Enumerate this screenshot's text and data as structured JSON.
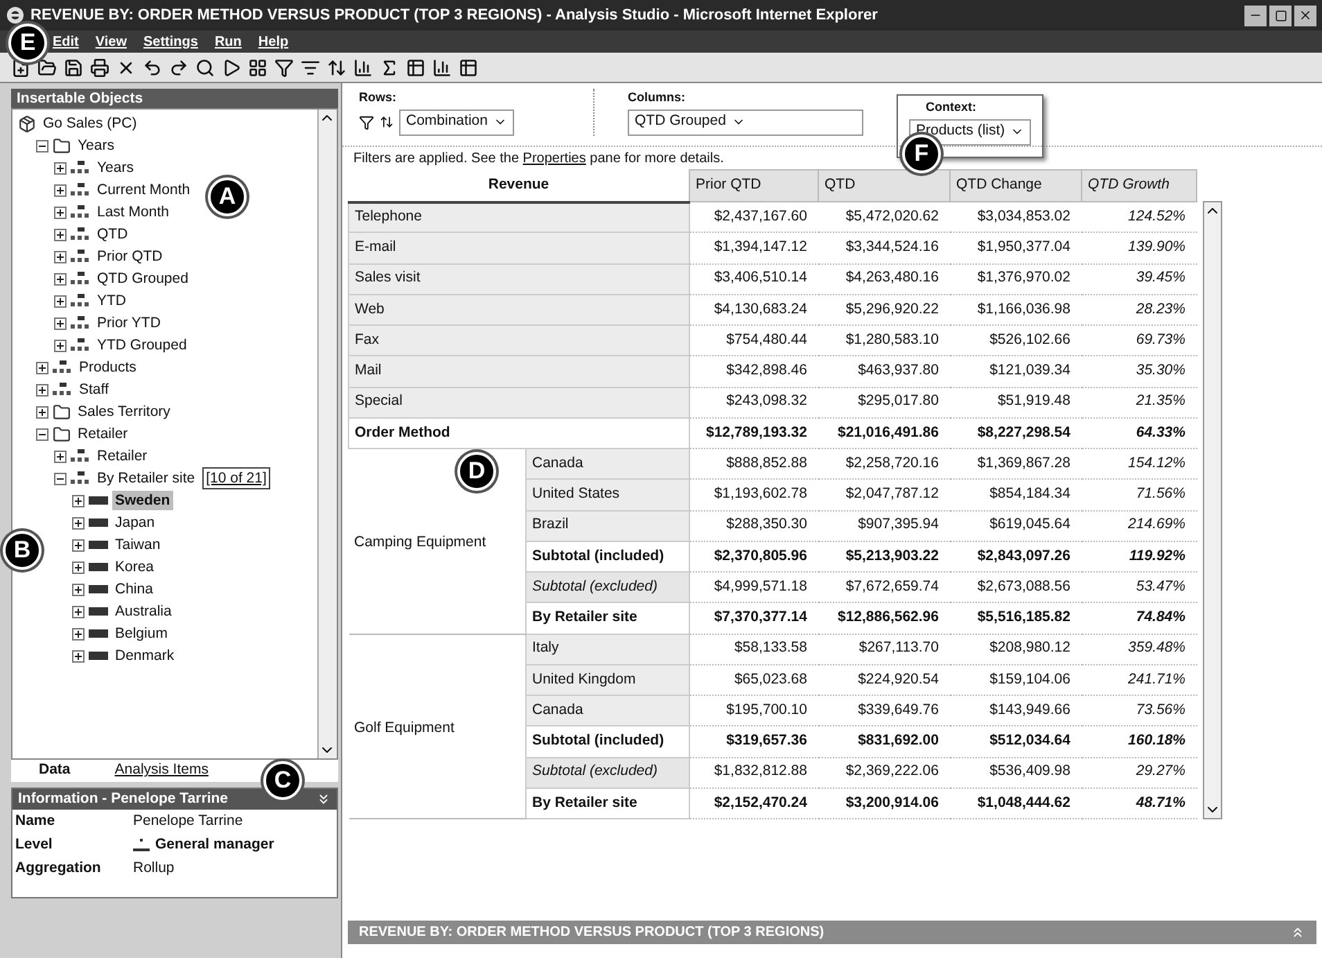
{
  "window": {
    "title": "REVENUE BY: ORDER METHOD VERSUS PRODUCT (TOP 3 REGIONS) - Analysis Studio - Microsoft Internet Explorer"
  },
  "menu": [
    "Edit",
    "View",
    "Settings",
    "Run",
    "Help"
  ],
  "insertable_objects": {
    "title": "Insertable Objects",
    "tree": [
      {
        "label": "Go Sales (PC)",
        "kind": "package",
        "selected": false,
        "children": [
          {
            "label": "Years",
            "kind": "folder",
            "expanded": true,
            "selected": false,
            "children": [
              {
                "label": "Years",
                "kind": "dimension",
                "expanded": false,
                "selected": false
              },
              {
                "label": "Current Month",
                "kind": "dimension",
                "expanded": false,
                "selected": false
              },
              {
                "label": "Last Month",
                "kind": "dimension",
                "expanded": false,
                "selected": false
              },
              {
                "label": "QTD",
                "kind": "dimension",
                "expanded": false,
                "selected": false
              },
              {
                "label": "Prior QTD",
                "kind": "dimension",
                "expanded": false,
                "selected": false
              },
              {
                "label": "QTD Grouped",
                "kind": "dimension",
                "expanded": false,
                "selected": false
              },
              {
                "label": "YTD",
                "kind": "dimension",
                "expanded": false,
                "selected": false
              },
              {
                "label": "Prior YTD",
                "kind": "dimension",
                "expanded": false,
                "selected": false
              },
              {
                "label": "YTD Grouped",
                "kind": "dimension",
                "expanded": false,
                "selected": false
              }
            ]
          },
          {
            "label": "Products",
            "kind": "dimension",
            "expanded": false,
            "selected": false
          },
          {
            "label": "Staff",
            "kind": "dimension",
            "expanded": false,
            "selected": false
          },
          {
            "label": "Sales Territory",
            "kind": "folder",
            "expanded": false,
            "selected": false
          },
          {
            "label": "Retailer",
            "kind": "folder",
            "expanded": true,
            "selected": false,
            "children": [
              {
                "label": "Retailer",
                "kind": "dimension",
                "expanded": false,
                "selected": false
              },
              {
                "label": "By Retailer site",
                "count": "[10 of 21]",
                "kind": "dimension",
                "expanded": true,
                "selected": false,
                "children": [
                  {
                    "label": "Sweden",
                    "kind": "member",
                    "expanded": false,
                    "selected": true
                  },
                  {
                    "label": "Japan",
                    "kind": "member",
                    "expanded": false,
                    "selected": false
                  },
                  {
                    "label": "Taiwan",
                    "kind": "member",
                    "expanded": false,
                    "selected": false
                  },
                  {
                    "label": "Korea",
                    "kind": "member",
                    "expanded": false,
                    "selected": false
                  },
                  {
                    "label": "China",
                    "kind": "member",
                    "expanded": false,
                    "selected": false
                  },
                  {
                    "label": "Australia",
                    "kind": "member",
                    "expanded": false,
                    "selected": false
                  },
                  {
                    "label": "Belgium",
                    "kind": "member",
                    "expanded": false,
                    "selected": false
                  },
                  {
                    "label": "Denmark",
                    "kind": "member",
                    "expanded": false,
                    "selected": false
                  }
                ]
              }
            ]
          }
        ]
      }
    ]
  },
  "pane_tabs": [
    {
      "label": "Data",
      "selected": true
    },
    {
      "label": "Analysis Items",
      "selected": false
    }
  ],
  "information": {
    "title": "Information - Penelope Tarrine",
    "rows": [
      {
        "label": "Name",
        "value": "Penelope Tarrine",
        "kind": "text"
      },
      {
        "label": "Level",
        "value": "General manager",
        "kind": "level"
      },
      {
        "label": "Aggregation",
        "value": "Rollup",
        "kind": "text"
      }
    ]
  },
  "overview": {
    "rows_label": "Rows:",
    "rows_value": "Combination",
    "columns_label": "Columns:",
    "columns_value": "QTD Grouped",
    "context_label": "Context:",
    "context_value": "Products (list)"
  },
  "filter_note": {
    "before": "Filters are applied. See the ",
    "link": "Properties",
    "after": " pane for more details."
  },
  "table": {
    "corner": "Revenue",
    "columns": [
      "Prior QTD",
      "QTD",
      "QTD Change",
      "QTD Growth"
    ],
    "sections": [
      {
        "rows": [
          {
            "label": "Telephone",
            "kind": "member",
            "values": [
              "$2,437,167.60",
              "$5,472,020.62",
              "$3,034,853.02",
              "124.52%"
            ]
          },
          {
            "label": "E-mail",
            "kind": "member",
            "values": [
              "$1,394,147.12",
              "$3,344,524.16",
              "$1,950,377.04",
              "139.90%"
            ]
          },
          {
            "label": "Sales visit",
            "kind": "member",
            "values": [
              "$3,406,510.14",
              "$4,263,480.16",
              "$1,376,970.02",
              "39.45%"
            ]
          },
          {
            "label": "Web",
            "kind": "member",
            "values": [
              "$4,130,683.24",
              "$5,296,920.22",
              "$1,166,036.98",
              "28.23%"
            ]
          },
          {
            "label": "Fax",
            "kind": "member",
            "values": [
              "$754,480.44",
              "$1,280,583.10",
              "$526,102.66",
              "69.73%"
            ]
          },
          {
            "label": "Mail",
            "kind": "member",
            "values": [
              "$342,898.46",
              "$463,937.80",
              "$121,039.34",
              "35.30%"
            ]
          },
          {
            "label": "Special",
            "kind": "member",
            "values": [
              "$243,098.32",
              "$295,017.80",
              "$51,919.48",
              "21.35%"
            ]
          },
          {
            "label": "Order Method",
            "kind": "total",
            "values": [
              "$12,789,193.32",
              "$21,016,491.86",
              "$8,227,298.54",
              "64.33%"
            ]
          }
        ]
      },
      {
        "group": "Camping Equipment",
        "rows": [
          {
            "label": "Canada",
            "kind": "member",
            "values": [
              "$888,852.88",
              "$2,258,720.16",
              "$1,369,867.28",
              "154.12%"
            ]
          },
          {
            "label": "United States",
            "kind": "member",
            "values": [
              "$1,193,602.78",
              "$2,047,787.12",
              "$854,184.34",
              "71.56%"
            ]
          },
          {
            "label": "Brazil",
            "kind": "member",
            "values": [
              "$288,350.30",
              "$907,395.94",
              "$619,045.64",
              "214.69%"
            ]
          },
          {
            "label": "Subtotal (included)",
            "kind": "total",
            "values": [
              "$2,370,805.96",
              "$5,213,903.22",
              "$2,843,097.26",
              "119.92%"
            ]
          },
          {
            "label": "Subtotal (excluded)",
            "kind": "excluded",
            "values": [
              "$4,999,571.18",
              "$7,672,659.74",
              "$2,673,088.56",
              "53.47%"
            ]
          },
          {
            "label": "By Retailer site",
            "kind": "total",
            "values": [
              "$7,370,377.14",
              "$12,886,562.96",
              "$5,516,185.82",
              "74.84%"
            ]
          }
        ]
      },
      {
        "group": "Golf Equipment",
        "rows": [
          {
            "label": "Italy",
            "kind": "member",
            "values": [
              "$58,133.58",
              "$267,113.70",
              "$208,980.12",
              "359.48%"
            ]
          },
          {
            "label": "United Kingdom",
            "kind": "member",
            "values": [
              "$65,023.68",
              "$224,920.54",
              "$159,104.06",
              "241.71%"
            ]
          },
          {
            "label": "Canada",
            "kind": "member",
            "values": [
              "$195,700.10",
              "$339,649.76",
              "$143,949.66",
              "73.56%"
            ]
          },
          {
            "label": "Subtotal (included)",
            "kind": "total",
            "values": [
              "$319,657.36",
              "$831,692.00",
              "$512,034.64",
              "160.18%"
            ]
          },
          {
            "label": "Subtotal (excluded)",
            "kind": "excluded",
            "values": [
              "$1,832,812.88",
              "$2,369,222.06",
              "$536,409.98",
              "29.27%"
            ]
          },
          {
            "label": "By Retailer site",
            "kind": "total",
            "values": [
              "$2,152,470.24",
              "$3,200,914.06",
              "$1,048,444.62",
              "48.71%"
            ]
          }
        ]
      }
    ]
  },
  "status_bar": {
    "text": "REVENUE BY: ORDER METHOD VERSUS PRODUCT (TOP 3 REGIONS)"
  },
  "callouts": [
    "A",
    "B",
    "C",
    "D",
    "E",
    "F"
  ]
}
